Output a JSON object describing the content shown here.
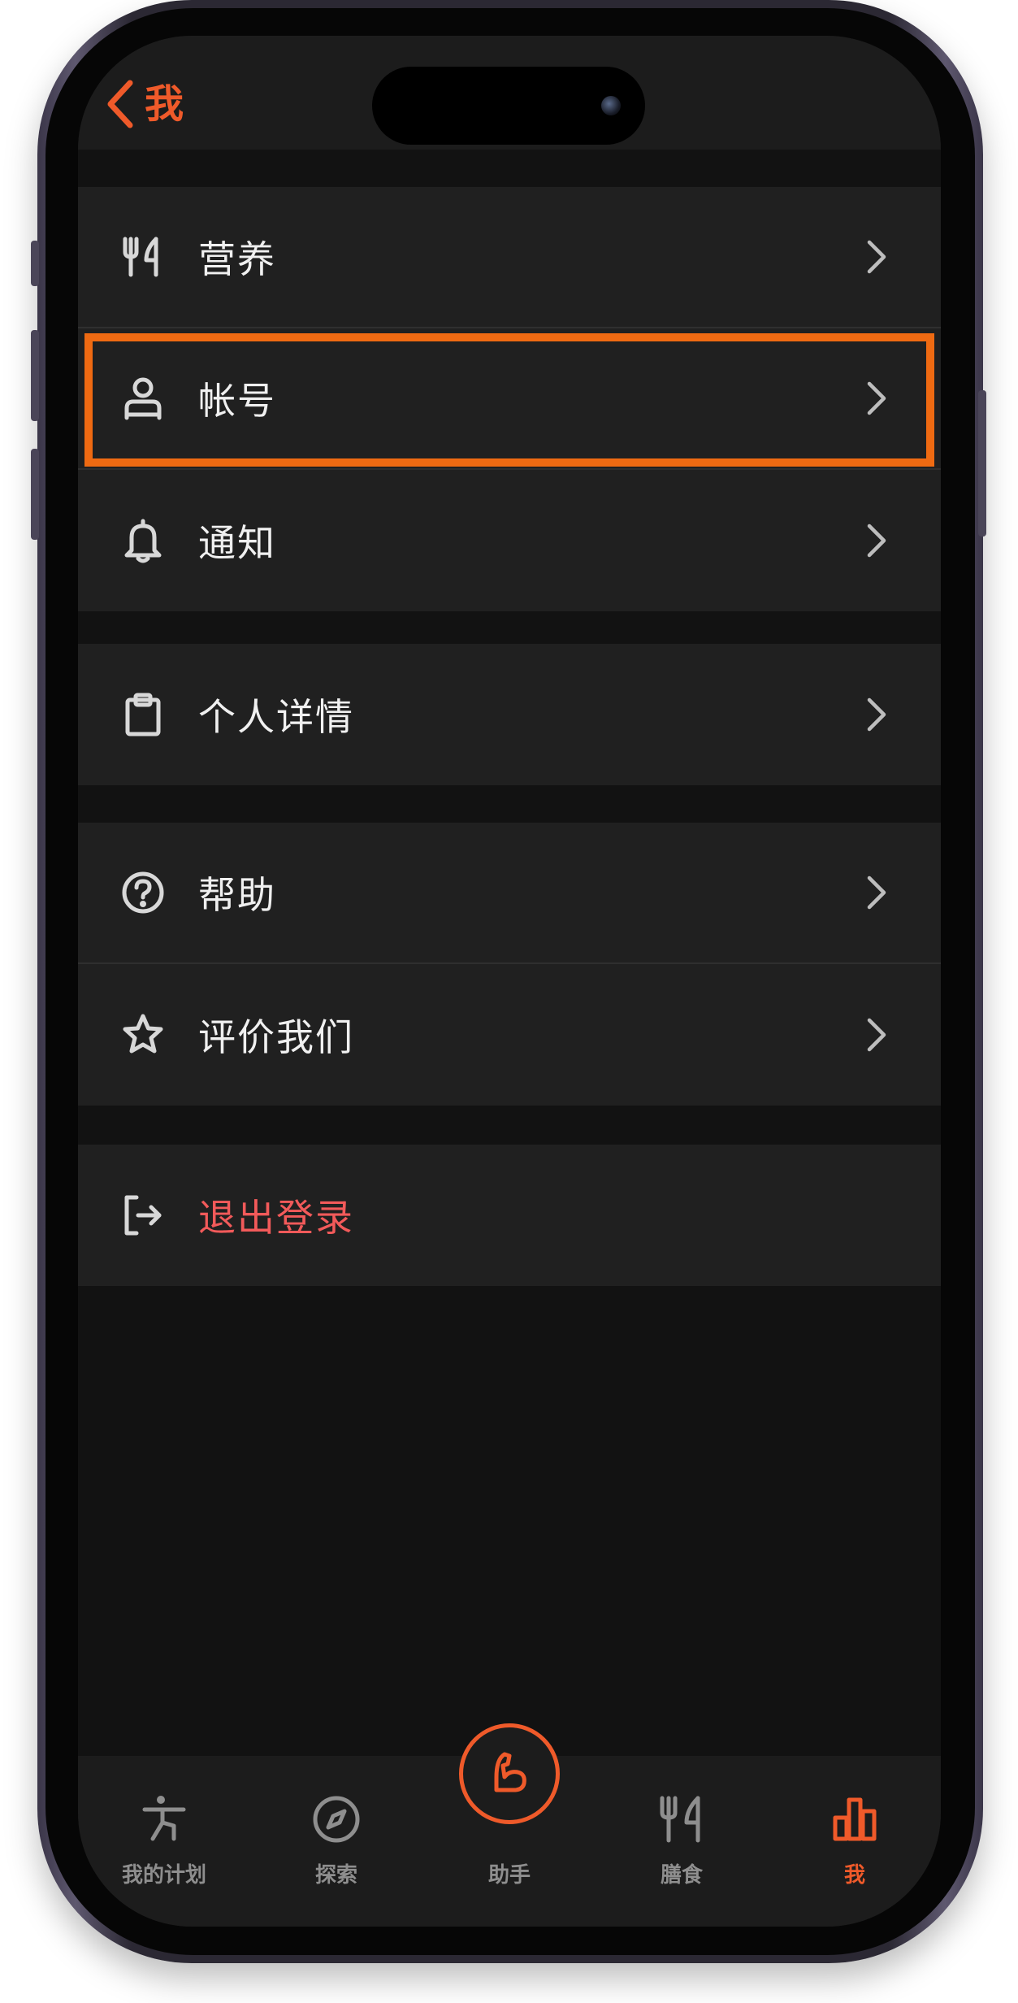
{
  "nav": {
    "back_label": "我"
  },
  "colors": {
    "accent": "#ef5a2a",
    "highlight": "#ef6a12",
    "danger": "#f25a5a",
    "background": "#121212",
    "row_background": "#202020"
  },
  "groups": [
    {
      "items": [
        {
          "icon": "fork-knife-icon",
          "label": "营养"
        },
        {
          "icon": "person-icon",
          "label": "帐号",
          "highlighted": true
        },
        {
          "icon": "bell-icon",
          "label": "通知"
        }
      ]
    },
    {
      "items": [
        {
          "icon": "clipboard-icon",
          "label": "个人详情"
        }
      ]
    },
    {
      "items": [
        {
          "icon": "help-circle-icon",
          "label": "帮助"
        },
        {
          "icon": "star-icon",
          "label": "评价我们"
        }
      ]
    },
    {
      "items": [
        {
          "icon": "logout-icon",
          "label": "退出登录",
          "danger": true
        }
      ]
    }
  ],
  "tabbar": {
    "tabs": [
      {
        "icon": "workout-figure-icon",
        "label": "我的计划",
        "active": false
      },
      {
        "icon": "compass-icon",
        "label": "探索",
        "active": false
      },
      {
        "icon": "flexed-arm-icon",
        "label": "助手",
        "active": false,
        "center": true
      },
      {
        "icon": "fork-knife-icon",
        "label": "膳食",
        "active": false
      },
      {
        "icon": "bar-chart-icon",
        "label": "我",
        "active": true
      }
    ]
  }
}
